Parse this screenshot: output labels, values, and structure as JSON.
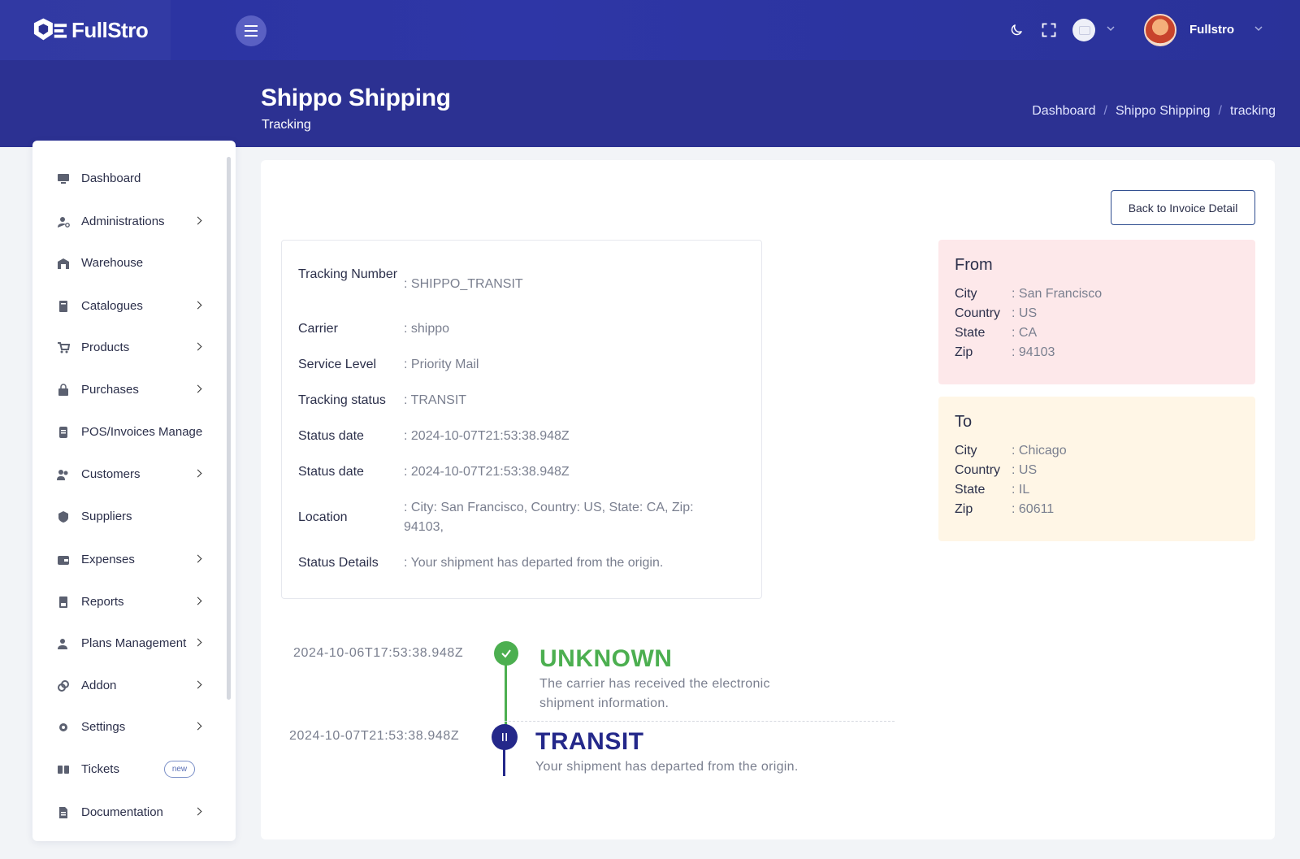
{
  "app": {
    "brand": "FullStro",
    "user_name": "Fullstro"
  },
  "header": {
    "title": "Shippo Shipping",
    "subtitle": "Tracking",
    "breadcrumb": [
      "Dashboard",
      "Shippo Shipping",
      "tracking"
    ]
  },
  "sidebar": {
    "items": [
      {
        "label": "Dashboard",
        "icon": "monitor-icon",
        "has_submenu": false
      },
      {
        "label": "Administrations",
        "icon": "user-gear-icon",
        "has_submenu": true
      },
      {
        "label": "Warehouse",
        "icon": "warehouse-icon",
        "has_submenu": false
      },
      {
        "label": "Catalogues",
        "icon": "book-icon",
        "has_submenu": true
      },
      {
        "label": "Products",
        "icon": "cart-icon",
        "has_submenu": true
      },
      {
        "label": "Purchases",
        "icon": "bag-icon",
        "has_submenu": true
      },
      {
        "label": "POS/Invoices Manage",
        "icon": "receipt-icon",
        "has_submenu": false
      },
      {
        "label": "Customers",
        "icon": "users-icon",
        "has_submenu": true
      },
      {
        "label": "Suppliers",
        "icon": "supplier-icon",
        "has_submenu": false
      },
      {
        "label": "Expenses",
        "icon": "wallet-icon",
        "has_submenu": true
      },
      {
        "label": "Reports",
        "icon": "report-icon",
        "has_submenu": true
      },
      {
        "label": "Plans Management",
        "icon": "user-plan-icon",
        "has_submenu": true
      },
      {
        "label": "Addon",
        "icon": "link-icon",
        "has_submenu": true
      },
      {
        "label": "Settings",
        "icon": "gear-icon",
        "has_submenu": true
      },
      {
        "label": "Tickets",
        "icon": "ticket-icon",
        "has_submenu": false,
        "badge": "new"
      },
      {
        "label": "Documentation",
        "icon": "document-icon",
        "has_submenu": true
      }
    ]
  },
  "actions": {
    "back_label": "Back to Invoice Detail"
  },
  "tracking": {
    "rows": [
      {
        "key": "Tracking Number",
        "value": ": SHIPPO_TRANSIT"
      },
      {
        "key": "Carrier",
        "value": ": shippo"
      },
      {
        "key": "Service Level",
        "value": ": Priority Mail"
      },
      {
        "key": "Tracking status",
        "value": ": TRANSIT"
      },
      {
        "key": "Status date",
        "value": ": 2024-10-07T21:53:38.948Z"
      },
      {
        "key": "Status date",
        "value": ": 2024-10-07T21:53:38.948Z"
      },
      {
        "key": "Location",
        "value": ": City: San Francisco, Country: US, State: CA, Zip: 94103,"
      },
      {
        "key": "Status Details",
        "value": ": Your shipment has departed from the origin."
      }
    ]
  },
  "from": {
    "title": "From",
    "rows": [
      {
        "key": "City",
        "value": ": San Francisco"
      },
      {
        "key": "Country",
        "value": ": US"
      },
      {
        "key": "State",
        "value": ": CA"
      },
      {
        "key": "Zip",
        "value": ": 94103"
      }
    ]
  },
  "to": {
    "title": "To",
    "rows": [
      {
        "key": "City",
        "value": ": Chicago"
      },
      {
        "key": "Country",
        "value": ": US"
      },
      {
        "key": "State",
        "value": ": IL"
      },
      {
        "key": "Zip",
        "value": ": 60611"
      }
    ]
  },
  "timeline": [
    {
      "date": "2024-10-06T17:53:38.948Z",
      "status": "UNKNOWN",
      "description": "The carrier has received the electronic shipment information.",
      "color": "#4caf50",
      "icon": "check-icon"
    },
    {
      "date": "2024-10-07T21:53:38.948Z",
      "status": "TRANSIT",
      "description": "Your shipment has departed from the origin.",
      "color": "#24288a",
      "icon": "pause-icon"
    }
  ],
  "colors": {
    "header_bg": "#2c3192",
    "accent": "#2c3192",
    "success": "#4caf50",
    "from_bg": "#fde8ea",
    "to_bg": "#fff6e6"
  }
}
